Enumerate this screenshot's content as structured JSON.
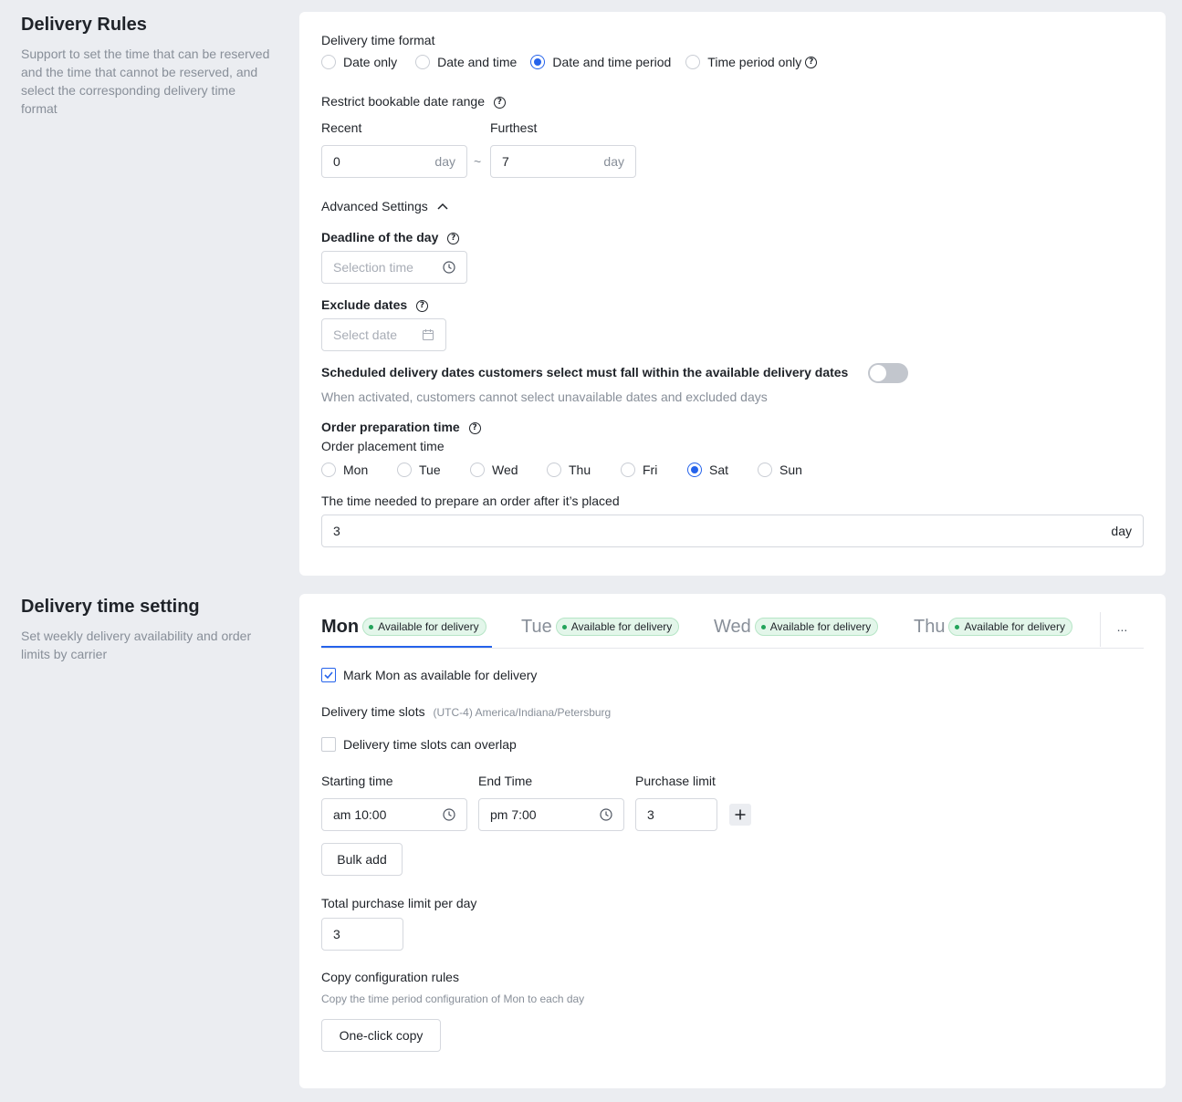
{
  "rules": {
    "title": "Delivery Rules",
    "description": "Support to set the time that can be reserved and the time that cannot be reserved, and select the corresponding delivery time format",
    "time_format": {
      "label": "Delivery time format",
      "options": [
        "Date only",
        "Date and time",
        "Date and time period",
        "Time period only"
      ],
      "selected": "Date and time period"
    },
    "date_range": {
      "label": "Restrict bookable date range",
      "recent_label": "Recent",
      "recent_value": "0",
      "furthest_label": "Furthest",
      "furthest_value": "7",
      "unit": "day",
      "separator": "~"
    },
    "advanced": {
      "label": "Advanced Settings",
      "deadline_label": "Deadline of the day",
      "deadline_placeholder": "Selection time",
      "exclude_label": "Exclude dates",
      "exclude_placeholder": "Select date",
      "must_fall_label": "Scheduled delivery dates customers select must fall within the available delivery dates",
      "must_fall_hint": "When activated, customers cannot select unavailable dates and excluded days",
      "must_fall_enabled": false
    },
    "prep": {
      "label": "Order preparation time",
      "placement_label": "Order placement time",
      "days": [
        "Mon",
        "Tue",
        "Wed",
        "Thu",
        "Fri",
        "Sat",
        "Sun"
      ],
      "selected_day": "Sat",
      "needed_label": "The time needed to prepare an order after it’s placed",
      "needed_value": "3",
      "unit": "day"
    }
  },
  "delivery": {
    "title": "Delivery time setting",
    "description": "Set weekly delivery availability and order limits by carrier",
    "tabs": [
      {
        "day": "Mon",
        "badge": "Available for delivery"
      },
      {
        "day": "Tue",
        "badge": "Available for delivery"
      },
      {
        "day": "Wed",
        "badge": "Available for delivery"
      },
      {
        "day": "Thu",
        "badge": "Available for delivery"
      }
    ],
    "active_tab": "Mon",
    "more_label": "...",
    "mark_available_label": "Mark Mon as available for delivery",
    "mark_available_checked": true,
    "slots_label": "Delivery time slots",
    "timezone": "(UTC-4) America/Indiana/Petersburg",
    "overlap_label": "Delivery time slots can overlap",
    "overlap_checked": false,
    "start_label": "Starting time",
    "end_label": "End Time",
    "limit_label": "Purchase limit",
    "start_value": "am 10:00",
    "end_value": "pm 7:00",
    "limit_value": "3",
    "bulk_add_label": "Bulk add",
    "total_limit_label": "Total purchase limit per day",
    "total_limit_value": "3",
    "copy_title": "Copy configuration rules",
    "copy_desc": "Copy the time period configuration of Mon to each day",
    "copy_button": "One-click copy"
  },
  "colors": {
    "accent": "#2563eb",
    "badge_bg": "#e3f6ea",
    "badge_dot": "#22a35a",
    "page_bg": "#ebedf1"
  }
}
